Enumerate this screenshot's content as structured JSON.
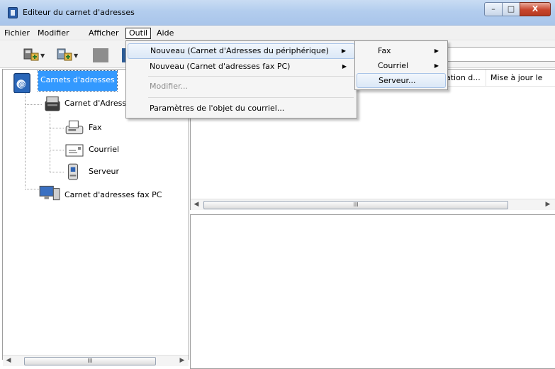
{
  "window": {
    "title": "Editeur du carnet d'adresses",
    "minimize": "–",
    "maximize": "□",
    "close": "X"
  },
  "menubar": {
    "items": [
      "Fichier",
      "Modifier",
      "Afficher",
      "Outil",
      "Aide"
    ],
    "open_menu": "Outil"
  },
  "outil_menu": {
    "items": [
      {
        "label": "Nouveau (Carnet d'Adresses du périphérique)",
        "submenu": true,
        "enabled": true,
        "highlighted": true
      },
      {
        "label": "Nouveau (Carnet d'adresses fax PC)",
        "submenu": true,
        "enabled": true
      },
      {
        "label": "Modifier...",
        "submenu": false,
        "enabled": false
      },
      {
        "label": "Paramètres de l'objet du courriel...",
        "submenu": false,
        "enabled": true
      }
    ]
  },
  "submenu": {
    "items": [
      {
        "label": "Fax",
        "submenu": true
      },
      {
        "label": "Courriel",
        "submenu": true
      },
      {
        "label": "Serveur...",
        "submenu": false,
        "highlighted": true
      }
    ]
  },
  "tree": {
    "root": "Carnets d'adresses",
    "device": "Carnet d'Adresse",
    "fax": "Fax",
    "mail": "Courriel",
    "server": "Serveur",
    "pc": "Carnet d'adresses fax PC"
  },
  "list": {
    "columns": [
      "ation d...",
      "Mise à jour le"
    ]
  },
  "scrollbar_grip": "III",
  "icons": {
    "app": "address-book-icon",
    "toolbar": [
      "address-book-add-icon",
      "address-book-add-icon"
    ],
    "tree": [
      "address-books-icon",
      "device-icon",
      "fax-icon",
      "envelope-icon",
      "server-icon",
      "pc-icon"
    ]
  },
  "colors": {
    "selection": "#3399ff",
    "menu_highlight": "#dbe8f7",
    "disabled_text": "#8c8c8c"
  }
}
